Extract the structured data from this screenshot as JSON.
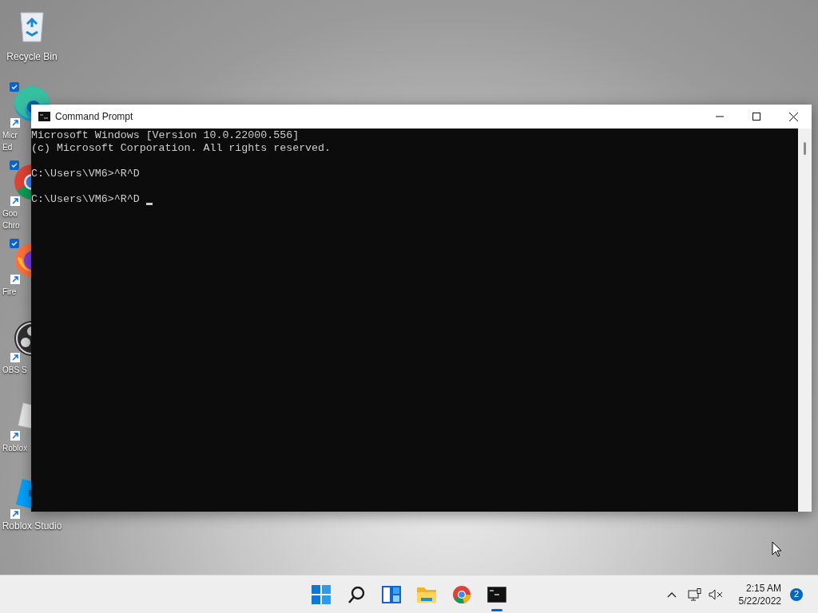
{
  "desktop_icons": [
    {
      "kind": "recycle",
      "label_lines": [
        "Recycle Bin"
      ],
      "checked": false,
      "shortcut": false
    },
    {
      "kind": "edge",
      "label_lines": [
        "Micr",
        "Ed"
      ],
      "checked": true,
      "shortcut": true
    },
    {
      "kind": "chrome",
      "label_lines": [
        "Goo",
        "Chro"
      ],
      "checked": true,
      "shortcut": true
    },
    {
      "kind": "firefox",
      "label_lines": [
        "Fire"
      ],
      "checked": true,
      "shortcut": true
    },
    {
      "kind": "obs",
      "label_lines": [
        "OBS S"
      ],
      "checked": false,
      "shortcut": true
    },
    {
      "kind": "roblox",
      "label_lines": [
        "Roblox"
      ],
      "checked": false,
      "shortcut": true
    },
    {
      "kind": "studio",
      "label_lines": [
        "Roblox Studio"
      ],
      "checked": false,
      "shortcut": true
    }
  ],
  "window": {
    "title": "Command Prompt",
    "blocks": [
      [
        "Microsoft Windows [Version 10.0.22000.556]",
        "(c) Microsoft Corporation. All rights reserved."
      ],
      [
        "C:\\Users\\VM6>^R^D"
      ],
      [
        "C:\\Users\\VM6>^R^D"
      ]
    ],
    "cursor": true
  },
  "taskbar": {
    "apps": [
      {
        "kind": "start",
        "active": false
      },
      {
        "kind": "search",
        "active": false
      },
      {
        "kind": "widgets",
        "active": false
      },
      {
        "kind": "explorer",
        "active": false
      },
      {
        "kind": "chrome",
        "active": false
      },
      {
        "kind": "terminal",
        "active": true
      }
    ],
    "time": "2:15 AM",
    "date": "5/22/2022",
    "notifications": "2"
  }
}
